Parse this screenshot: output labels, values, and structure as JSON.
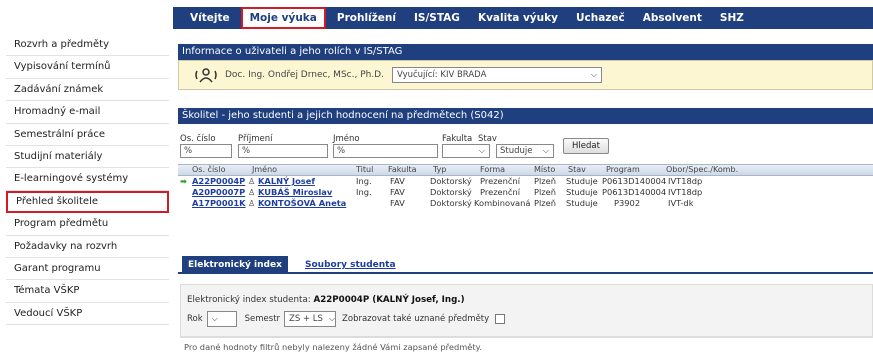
{
  "topnav": {
    "items": [
      "Vítejte",
      "Moje výuka",
      "Prohlížení",
      "IS/STAG",
      "Kvalita výuky",
      "Uchazeč",
      "Absolvent",
      "SHZ"
    ],
    "active_index": 1
  },
  "sidebar": {
    "items": [
      "Rozvrh a předměty",
      "Vypisování termínů",
      "Zadávání známek",
      "Hromadný e-mail",
      "Semestrální práce",
      "Studijní materiály",
      "E-learningové systémy",
      "Přehled školitele",
      "Program předmětu",
      "Požadavky na rozvrh",
      "Garant programu",
      "Témata VŠKP",
      "Vedoucí VŠKP"
    ],
    "active_index": 7
  },
  "info": {
    "header": "Informace o uživateli a jeho rolích v IS/STAG",
    "user_name": "Doc. Ing. Ondřej Drnec, MSc., Ph.D.",
    "role_select": "Vyučující: KIV BRADA"
  },
  "school": {
    "header": "Školitel - jeho studenti a jejich hodnocení na předmětech (S042)"
  },
  "filters": {
    "labels": [
      "Os. číslo",
      "Příjmení",
      "Jméno",
      "Fakulta",
      "Stav"
    ],
    "values": [
      "%",
      "%",
      "%",
      "",
      "Studuje"
    ],
    "search_label": "Hledat"
  },
  "grid": {
    "columns": [
      "Os. číslo",
      "Jméno",
      "Titul",
      "Fakulta",
      "Typ",
      "Forma",
      "Místo",
      "Stav",
      "Program",
      "Obor/Spec./Komb."
    ],
    "rows": [
      [
        "A22P0004P",
        "KALNÝ Josef",
        "Ing.",
        "FAV",
        "Doktorský",
        "Prezenční",
        "Plzeň",
        "Studuje",
        "P0613D140004",
        "IVT18dp"
      ],
      [
        "A20P0007P",
        "KUBÁŠ Miroslav",
        "Ing.",
        "FAV",
        "Doktorský",
        "Prezenční",
        "Plzeň",
        "Studuje",
        "P0613D140004",
        "IVT18dp"
      ],
      [
        "A17P0001K",
        "KONTOŠOVÁ Aneta",
        "",
        "FAV",
        "Doktorský",
        "Kombinovaná",
        "Plzeň",
        "Studuje",
        "P3902",
        "IVT-dk"
      ]
    ]
  },
  "tabs": {
    "items": [
      "Elektronický index",
      "Soubory studenta"
    ],
    "active_index": 0
  },
  "index": {
    "label_prefix": "Elektronický index studenta:",
    "student": "A22P0004P (KALNÝ Josef, Ing.)",
    "year_label": "Rok",
    "semester_label": "Semestr",
    "semester_value": "ZS + LS",
    "show_label": "Zobrazovat také uznané předměty",
    "empty_message": "Pro dané hodnoty filtrů nebyly nalezeny žádné Vámi zapsané předměty."
  }
}
